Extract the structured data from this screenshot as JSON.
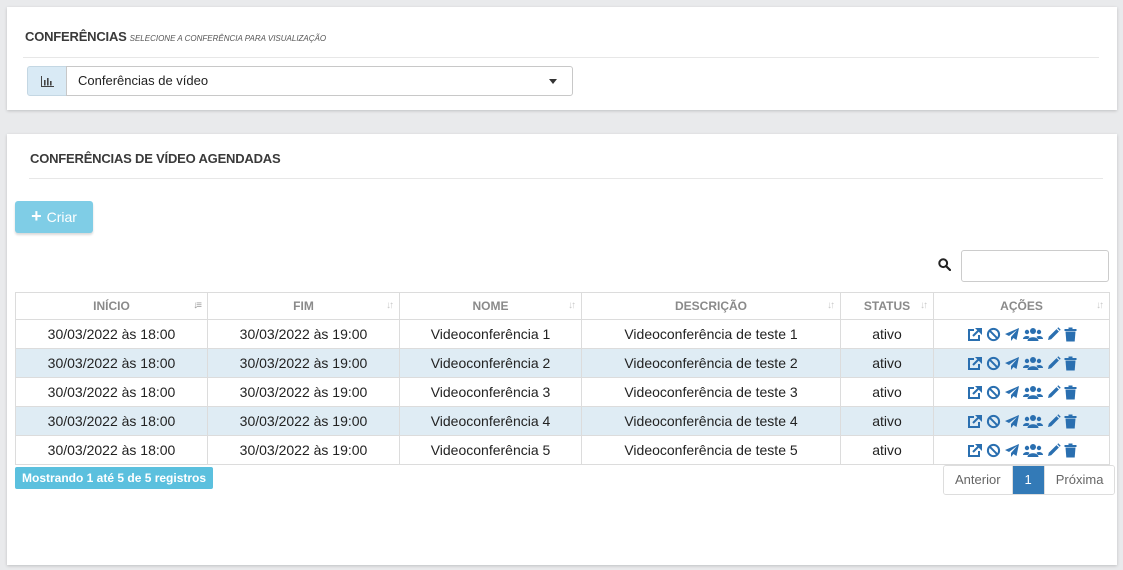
{
  "top_panel": {
    "title": "CONFERÊNCIAS",
    "subtitle": "SELECIONE A CONFERÊNCIA PARA VISUALIZAÇÃO",
    "select": {
      "addon_icon": "bar-chart-icon",
      "value": "Conferências de vídeo"
    }
  },
  "main_panel": {
    "title": "CONFERÊNCIAS DE VÍDEO AGENDADAS",
    "create_button": {
      "icon": "plus-icon",
      "label": "Criar"
    },
    "search": {
      "icon": "search-icon",
      "value": ""
    },
    "table": {
      "columns": [
        {
          "label": "INÍCIO",
          "sort": "asc"
        },
        {
          "label": "FIM",
          "sort": "none"
        },
        {
          "label": "NOME",
          "sort": "none"
        },
        {
          "label": "DESCRIÇÃO",
          "sort": "none"
        },
        {
          "label": "STATUS",
          "sort": "none"
        },
        {
          "label": "AÇÕES",
          "sort": "none"
        }
      ],
      "rows": [
        {
          "inicio": "30/03/2022 às 18:00",
          "fim": "30/03/2022 às 19:00",
          "nome": "Videoconferência 1",
          "descricao": "Videoconferência de teste 1",
          "status": "ativo"
        },
        {
          "inicio": "30/03/2022 às 18:00",
          "fim": "30/03/2022 às 19:00",
          "nome": "Videoconferência 2",
          "descricao": "Videoconferência de teste 2",
          "status": "ativo"
        },
        {
          "inicio": "30/03/2022 às 18:00",
          "fim": "30/03/2022 às 19:00",
          "nome": "Videoconferência 3",
          "descricao": "Videoconferência de teste 3",
          "status": "ativo"
        },
        {
          "inicio": "30/03/2022 às 18:00",
          "fim": "30/03/2022 às 19:00",
          "nome": "Videoconferência 4",
          "descricao": "Videoconferência de teste 4",
          "status": "ativo"
        },
        {
          "inicio": "30/03/2022 às 18:00",
          "fim": "30/03/2022 às 19:00",
          "nome": "Videoconferência 5",
          "descricao": "Videoconferência de teste 5",
          "status": "ativo"
        }
      ],
      "row_actions": [
        "external-link-icon",
        "ban-icon",
        "send-icon",
        "users-icon",
        "pencil-icon",
        "trash-icon"
      ]
    },
    "info": "Mostrando 1 até 5 de 5 registros",
    "pagination": {
      "previous": "Anterior",
      "current": "1",
      "next": "Próxima"
    }
  },
  "colors": {
    "accent": "#337ab7",
    "info": "#5bc0de",
    "create_button": "#7fcde6",
    "striped_row": "#dfecf4"
  }
}
